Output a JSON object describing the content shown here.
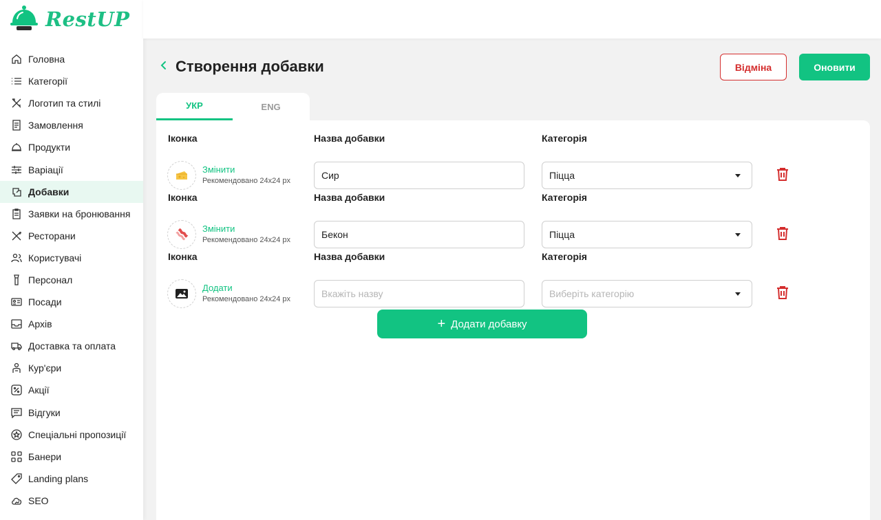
{
  "app": {
    "logo_text": "RestUP",
    "brand_color": "#12c382",
    "danger_color": "#d42d2d"
  },
  "sidebar": {
    "items": [
      {
        "label": "Головна",
        "icon": "home-icon"
      },
      {
        "label": "Категорії",
        "icon": "list-icon"
      },
      {
        "label": "Логотип та стилі",
        "icon": "tools-icon"
      },
      {
        "label": "Замовлення",
        "icon": "receipt-icon"
      },
      {
        "label": "Продукти",
        "icon": "dish-icon"
      },
      {
        "label": "Варіації",
        "icon": "sliders-icon"
      },
      {
        "label": "Добавки",
        "icon": "addons-icon",
        "active": true
      },
      {
        "label": "Заявки на бронювання",
        "icon": "clipboard-icon"
      },
      {
        "label": "Ресторани",
        "icon": "cutlery-icon"
      },
      {
        "label": "Користувачі",
        "icon": "users-icon"
      },
      {
        "label": "Персонал",
        "icon": "staff-icon"
      },
      {
        "label": "Посади",
        "icon": "id-card-icon"
      },
      {
        "label": "Архів",
        "icon": "archive-icon"
      },
      {
        "label": "Доставка та оплата",
        "icon": "truck-icon"
      },
      {
        "label": "Кур'єри",
        "icon": "courier-icon"
      },
      {
        "label": "Акції",
        "icon": "percent-icon"
      },
      {
        "label": "Відгуки",
        "icon": "reviews-icon"
      },
      {
        "label": "Спеціальні пропозиції",
        "icon": "star-icon"
      },
      {
        "label": "Банери",
        "icon": "grid-icon"
      },
      {
        "label": "Landing plans",
        "icon": "tag-icon"
      },
      {
        "label": "SEO",
        "icon": "seo-icon"
      }
    ]
  },
  "header": {
    "title": "Створення добавки",
    "cancel_label": "Відміна",
    "update_label": "Оновити"
  },
  "tabs": [
    {
      "label": "УКР",
      "active": true
    },
    {
      "label": "ENG",
      "active": false
    }
  ],
  "form": {
    "icon_label": "Іконка",
    "name_label": "Назва добавки",
    "category_label": "Категорія",
    "hint": "Рекомендовано 24x24 px",
    "rows": [
      {
        "icon": "cheese-icon",
        "action": "Змінити",
        "name": "Сир",
        "name_placeholder": "Вкажіть назву",
        "category": "Піцца"
      },
      {
        "icon": "bacon-icon",
        "action": "Змінити",
        "name": "Бекон",
        "name_placeholder": "Вкажіть назву",
        "category": "Піцца"
      },
      {
        "icon": "image-placeholder-icon",
        "action": "Додати",
        "name": "",
        "name_placeholder": "Вкажіть назву",
        "category": "",
        "category_placeholder": "Виберіть  категорію"
      }
    ],
    "add_button_label": "Додати добавку"
  }
}
